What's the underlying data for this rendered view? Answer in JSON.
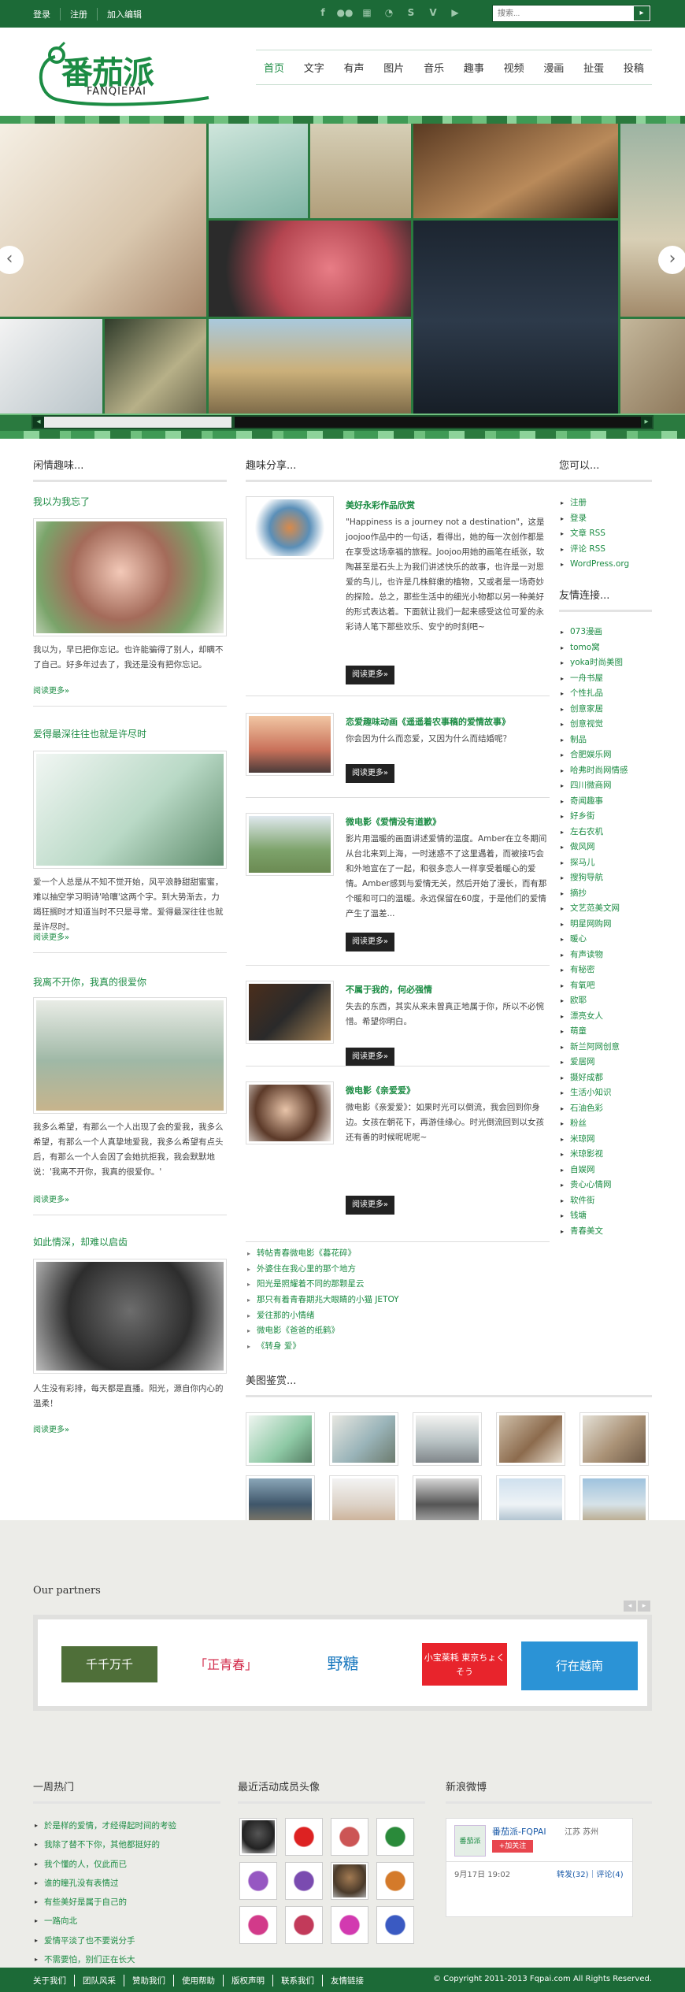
{
  "topbar": {
    "links": [
      "登录",
      "注册",
      "加入编辑"
    ],
    "social_icons": [
      "facebook-icon",
      "flickr-icon",
      "delicious-icon",
      "rss-icon",
      "skype-icon",
      "vimeo-icon",
      "youtube-icon"
    ],
    "search_placeholder": "搜索...",
    "search_button": "▸"
  },
  "logo": {
    "text": "番茄派",
    "subtext": "FANQIEPAI"
  },
  "nav": {
    "items": [
      "首页",
      "文字",
      "有声",
      "图片",
      "音乐",
      "趣事",
      "视频",
      "漫画",
      "扯蛋",
      "投稿"
    ],
    "active": "首页"
  },
  "left_column": {
    "heading": "闲情趣味...",
    "posts": [
      {
        "title": "我以为我忘了",
        "text": "我以为，早已把你忘记。也许能骗得了别人，却瞒不了自己。好多年过去了，我还是没有把你忘记。",
        "more": "阅读更多»"
      },
      {
        "title": "爱得最深往往也就是许尽时",
        "text": "爱一个人总是从不知不觉开始，风平浪静甜甜蜜蜜，难以抽空学习明诗'哈嚷'这两个字。到大势渐去，力竭狂搁时才知道当时不只是寻常。爱得最深往往也就是许尽时。",
        "more": "阅读更多»"
      },
      {
        "title": "我离不开你，我真的很爱你",
        "text": "我多么希望，有那么一个人出现了会的爱我，我多么希望，有那么一个人真挚地爱我，我多么希望有点头后，有那么一个人会因了会她抗拒我，我会默默地说：'我离不开你，我真的很爱你。'",
        "more": "阅读更多»"
      },
      {
        "title": "如此情深，却难以启齿",
        "text": "人生没有彩排，每天都是直播。阳光，源自你内心的温柔！",
        "more": "阅读更多»"
      }
    ]
  },
  "middle_column": {
    "heading": "趣味分享...",
    "items": [
      {
        "title": "美好永彩作品欣赏",
        "text": "\"Happiness is a journey not a destination\"，这是joojoo作品中的一句话，看得出，她的每一次创作都是在享受这场幸福的旅程。Joojoo用她的画笔在纸张，软陶甚至是石头上为我们讲述快乐的故事，也许是一对恩爱的鸟儿，也许是几株鲜嫩的植物，又或者是一场奇妙的探险。总之，那些生活中的细光小物都以另一种美好的形式表达着。下面就让我们一起来感受这位可爱的永彩诗人笔下那些欢乐、安宁的时刻吧~",
        "button": "阅读更多»"
      },
      {
        "title": "恋爱趣味动画《遥遥着农事稿的爱情故事》",
        "text": "你会因为什么而恋爱，又因为什么而结婚呢？",
        "button": "阅读更多»"
      },
      {
        "title": "微电影《爱情没有道歉》",
        "text": "影片用温暖的画面讲述爱情的温度。Amber在立冬期间从台北来到上海，一时迷惑不了这里遇着，而被接巧会和外地宣在了一起，和很多恋人一样享受着暖心的爱情。Amber感到与爱情无关，然后开始了漫长，而有那个暖和可口的温暖。永远保留在60度，于是他们的爱情产生了温差...",
        "button": "阅读更多»"
      },
      {
        "title": "不属于我的，何必强情",
        "text": "失去的东西，其实从来未曾真正地属于你，所以不必惋惜。希望你明白。",
        "button": "阅读更多»"
      },
      {
        "title": "微电影《亲爱爱》",
        "text": "微电影《亲爱爱》：如果时光可以倒流，我会回到你身边。女孩在朝花下，再游佳缘心。时光倒流回到以女孩还有善的时候呢呢呢~",
        "button": "阅读更多»"
      }
    ],
    "links": [
      "转帖青春微电影《暮花碎》",
      "外婆住在我心里的那个地方",
      "阳光是照耀着不同的那颗星云",
      "那只有着青春期兆大眼睛的小猫 JETOY",
      "爱往那的小情绪",
      "微电影《爸爸的纸鹤》",
      "《转身 爱》"
    ],
    "gallery_heading": "美图鉴赏..."
  },
  "right_column": {
    "heading1": "您可以...",
    "links1": [
      "注册",
      "登录",
      "文章 RSS",
      "评论 RSS",
      "WordPress.org"
    ],
    "heading2": "友情连接...",
    "links2": [
      "073漫画",
      "tomo窝",
      "yoka时尚美图",
      "一舟书屋",
      "个性扎品",
      "创意家居",
      "创意视觉",
      "制品",
      "合肥娱乐网",
      "哈弗时尚网情感",
      "四川微商网",
      "奇闻趣事",
      "好乡街",
      "左右农机",
      "做风网",
      "探马儿",
      "搜狗导航",
      "摘抄",
      "文艺范美文网",
      "明星网购网",
      "暖心",
      "有声读物",
      "有秘密",
      "有氧吧",
      "欧耶",
      "漂亮女人",
      "萌童",
      "新兰阿网创意",
      "爱居网",
      "摄好成都",
      "生活小知识",
      "石油色彩",
      "粉丝",
      "米琼网",
      "米琼影视",
      "自娱网",
      "贵心心情网",
      "软件街",
      "钱塘",
      "青春美文"
    ]
  },
  "footer": {
    "partners_heading": "Our partners",
    "partners": [
      "千千万千",
      "「正青春」",
      "野糖",
      "小宝莱耗 東京ちょくそう",
      "行在越南"
    ],
    "hot_heading": "一周热门",
    "hot_links": [
      "於是样的爱情，才经得起时间的考验",
      "我除了替不下你，其他都挺好的",
      "我个懂的人，仅此而已",
      "谁的瞳孔没有表情过",
      "有些美好是属于自己的",
      "一路向北",
      "爱情平淡了也不要说分手",
      "不需要怕，别们正在长大"
    ],
    "members_heading": "最近活动成员头像",
    "weibo_heading": "新浪微博",
    "weibo_name": "番茄派-FQPAI",
    "weibo_location": "江苏 苏州",
    "weibo_follow": "+加关注",
    "weibo_date": "9月17日 19:02",
    "weibo_stats": "转发(32)｜评论(4)",
    "bottom_links": [
      "关于我们",
      "团队风采",
      "赞助我们",
      "使用帮助",
      "版权声明",
      "联系我们",
      "友情链接"
    ],
    "copyright": "© Copyright 2011-2013 Fqpai.com All Rights Reserved."
  }
}
